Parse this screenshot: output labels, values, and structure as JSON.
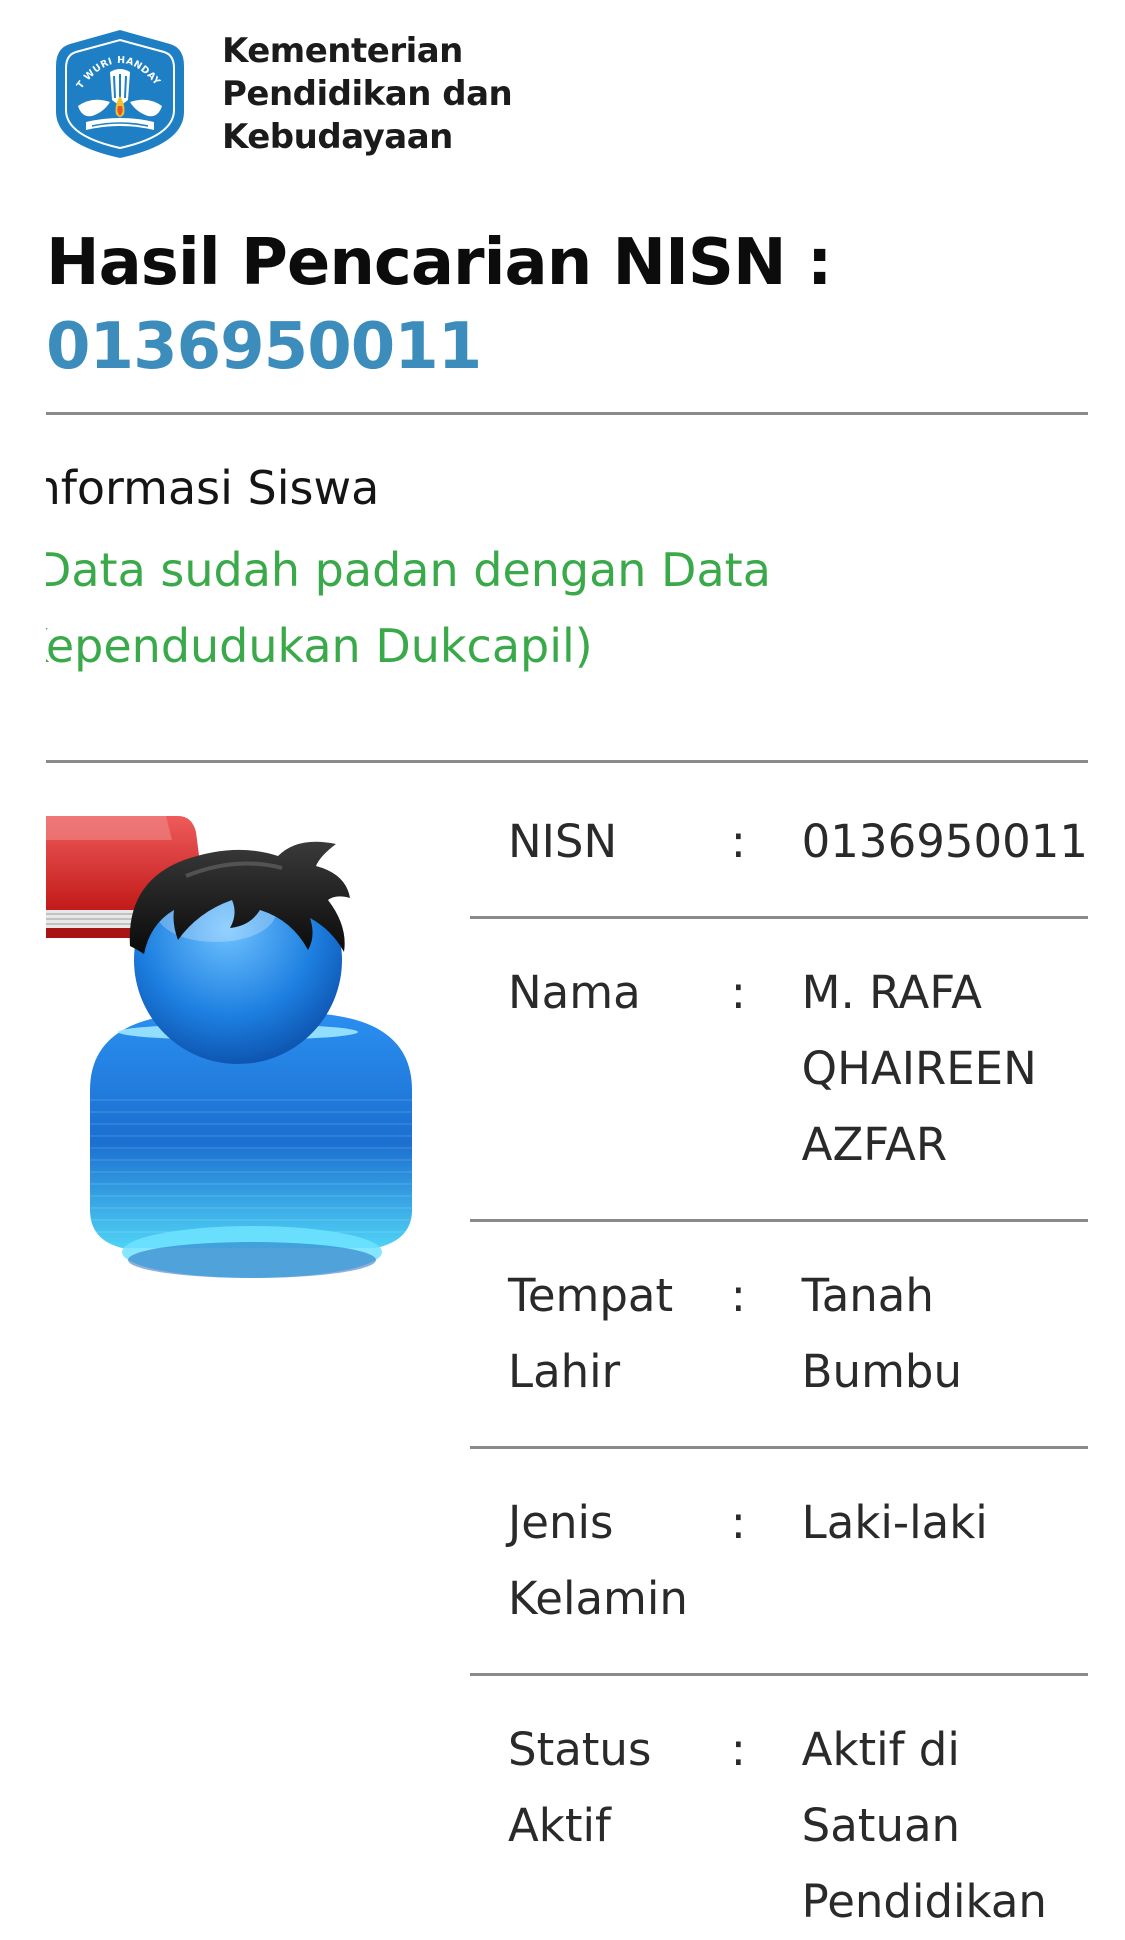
{
  "header": {
    "logo_name": "tut-wuri-handayani-logo",
    "logo_text": "TUT WURI HANDAYANI",
    "ministry_name": "Kementerian\nPendidikan dan\nKebudayaan"
  },
  "result": {
    "title": "Hasil Pencarian NISN :",
    "nisn": "0136950011"
  },
  "section": {
    "title": "Informasi Siswa",
    "verification_note": "(Data sudah padan dengan Data Kependudukan Dukcapil)"
  },
  "student": {
    "avatar_icon": "student-avatar-icon",
    "rows": [
      {
        "label": "NISN",
        "colon": ":",
        "value": "0136950011"
      },
      {
        "label": "Nama",
        "colon": ":",
        "value": "M. RAFA QHAIREEN AZFAR"
      },
      {
        "label": "Tempat Lahir",
        "colon": ":",
        "value": "Tanah Bumbu"
      },
      {
        "label": "Jenis Kelamin",
        "colon": ":",
        "value": "Laki-laki"
      },
      {
        "label": "Status Aktif",
        "colon": ":",
        "value": "Aktif di Satuan Pendidikan"
      }
    ]
  },
  "colors": {
    "accent": "#3c8dbc",
    "success": "#39a94a",
    "rule": "#8a8a8a",
    "logo_blue": "#1f7fc4"
  }
}
